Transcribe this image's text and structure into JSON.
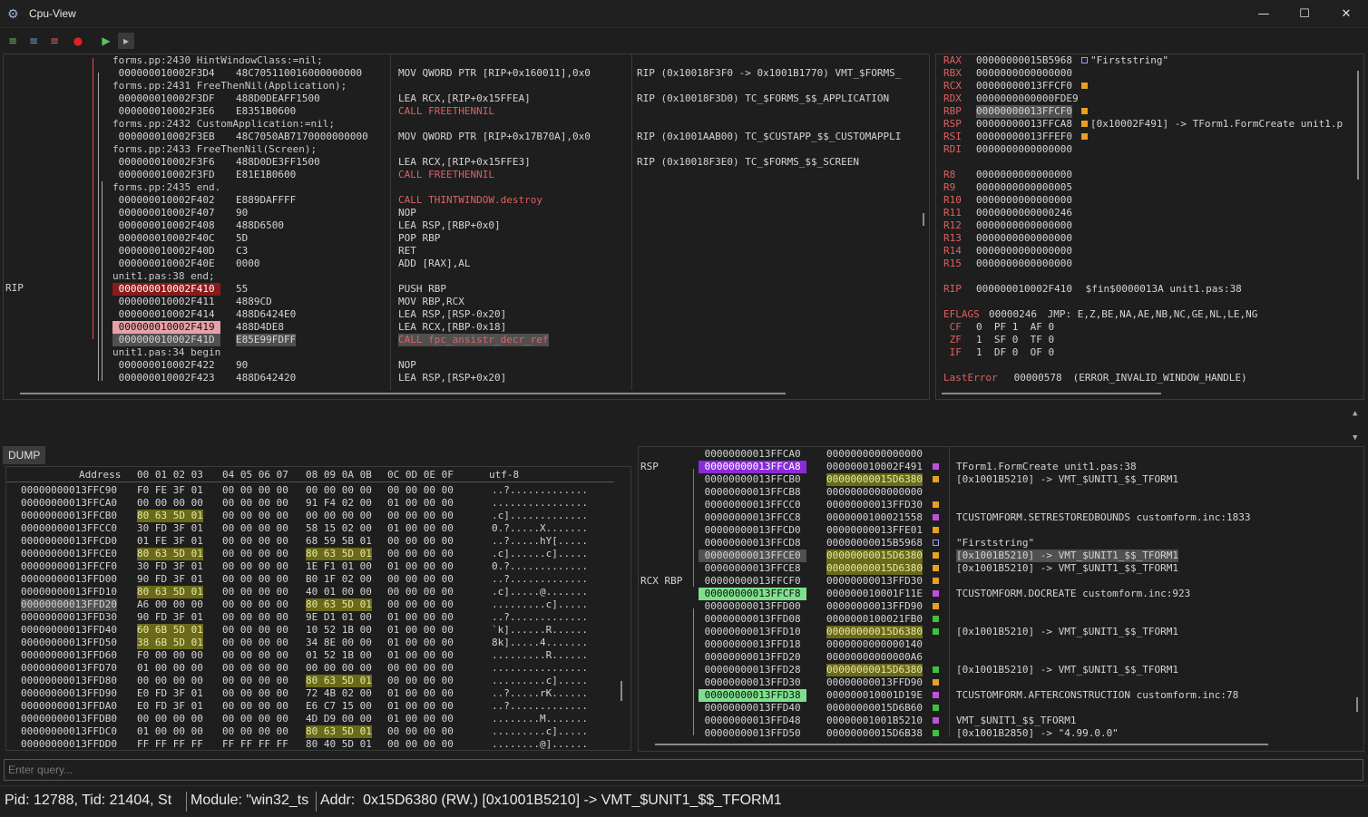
{
  "window": {
    "title": "Cpu-View",
    "minimize": "—",
    "maximize": "☐",
    "close": "✕"
  },
  "toolbar": {
    "buttons": [
      "step-into",
      "step-over",
      "step-out",
      "stop",
      "run-to",
      "run"
    ]
  },
  "disasm": {
    "rip_label": "RIP",
    "rows": [
      {
        "a": "forms.pp:2430 HintWindowClass:=nil;",
        "b": "",
        "c": "",
        "d": "",
        "t": "src"
      },
      {
        "a": "000000010002F3D4",
        "b": "48C705110016000000000",
        "c": "MOV QWORD PTR [RIP+0x160011],0x0",
        "d": "RIP (0x10018F3F0 -> 0x1001B1770) VMT_$FORMS_",
        "t": "code"
      },
      {
        "a": "forms.pp:2431 FreeThenNil(Application);",
        "b": "",
        "c": "",
        "d": "",
        "t": "src"
      },
      {
        "a": "000000010002F3DF",
        "b": "488D0DEAFF1500",
        "c": "LEA RCX,[RIP+0x15FFEA]",
        "d": "RIP (0x10018F3D0) TC_$FORMS_$$_APPLICATION",
        "t": "code"
      },
      {
        "a": "000000010002F3E6",
        "b": "E8351B0600",
        "c": "CALL FREETHENNIL",
        "d": "",
        "t": "code"
      },
      {
        "a": "forms.pp:2432 CustomApplication:=nil;",
        "b": "",
        "c": "",
        "d": "",
        "t": "src"
      },
      {
        "a": "000000010002F3EB",
        "b": "48C7050AB7170000000000",
        "c": "MOV QWORD PTR [RIP+0x17B70A],0x0",
        "d": "RIP (0x1001AAB00) TC_$CUSTAPP_$$_CUSTOMAPPLI",
        "t": "code"
      },
      {
        "a": "forms.pp:2433 FreeThenNil(Screen);",
        "b": "",
        "c": "",
        "d": "",
        "t": "src"
      },
      {
        "a": "000000010002F3F6",
        "b": "488D0DE3FF1500",
        "c": "LEA RCX,[RIP+0x15FFE3]",
        "d": "RIP (0x10018F3E0) TC_$FORMS_$$_SCREEN",
        "t": "code"
      },
      {
        "a": "000000010002F3FD",
        "b": "E81E1B0600",
        "c": "CALL FREETHENNIL",
        "d": "",
        "t": "code"
      },
      {
        "a": "forms.pp:2435 end.",
        "b": "",
        "c": "",
        "d": "",
        "t": "src"
      },
      {
        "a": "000000010002F402",
        "b": "E889DAFFFF",
        "c": "CALL THINTWINDOW.destroy",
        "d": "",
        "t": "code"
      },
      {
        "a": "000000010002F407",
        "b": "90",
        "c": "NOP",
        "d": "",
        "t": "code"
      },
      {
        "a": "000000010002F408",
        "b": "488D6500",
        "c": "LEA RSP,[RBP+0x0]",
        "d": "",
        "t": "code"
      },
      {
        "a": "000000010002F40C",
        "b": "5D",
        "c": "POP RBP",
        "d": "",
        "t": "code"
      },
      {
        "a": "000000010002F40D",
        "b": "C3",
        "c": "RET",
        "d": "",
        "t": "code"
      },
      {
        "a": "000000010002F40E",
        "b": "0000",
        "c": "ADD [RAX],AL",
        "d": "",
        "t": "code"
      },
      {
        "a": "unit1.pas:38 end;",
        "b": "",
        "c": "",
        "d": "",
        "t": "src"
      },
      {
        "a": "000000010002F410",
        "b": "55",
        "c": "PUSH RBP",
        "d": "",
        "t": "rip"
      },
      {
        "a": "000000010002F411",
        "b": "4889CD",
        "c": "MOV RBP,RCX",
        "d": "",
        "t": "code"
      },
      {
        "a": "000000010002F414",
        "b": "488D6424E0",
        "c": "LEA RSP,[RSP-0x20]",
        "d": "",
        "t": "code"
      },
      {
        "a": "000000010002F419",
        "b": "488D4DE8",
        "c": "LEA RCX,[RBP-0x18]",
        "d": "",
        "t": "pink"
      },
      {
        "a": "000000010002F41D",
        "b": "E85E99FDFF",
        "c": "CALL fpc_ansistr_decr_ref",
        "d": "",
        "t": "gray"
      },
      {
        "a": "unit1.pas:34 begin",
        "b": "",
        "c": "",
        "d": "",
        "t": "src"
      },
      {
        "a": "000000010002F422",
        "b": "90",
        "c": "NOP",
        "d": "",
        "t": "code"
      },
      {
        "a": "000000010002F423",
        "b": "488D642420",
        "c": "LEA RSP,[RSP+0x20]",
        "d": "",
        "t": "code"
      }
    ]
  },
  "registers": {
    "rows": [
      {
        "n": "RAX",
        "v": "00000000015B5968",
        "m": "b",
        "x": "\"Firststring\""
      },
      {
        "n": "RBX",
        "v": "0000000000000000",
        "m": "",
        "x": ""
      },
      {
        "n": "RCX",
        "v": "00000000013FFCF0",
        "m": "o",
        "x": ""
      },
      {
        "n": "RDX",
        "v": "0000000000000FDE9",
        "m": "",
        "x": ""
      },
      {
        "n": "RBP",
        "v": "00000000013FFCF0",
        "m": "o",
        "x": ""
      },
      {
        "n": "RSP",
        "v": "00000000013FFCA8",
        "m": "o",
        "x": "[0x10002F491] -> TForm1.FormCreate unit1.p"
      },
      {
        "n": "RSI",
        "v": "00000000013FFEF0",
        "m": "o",
        "x": ""
      },
      {
        "n": "RDI",
        "v": "0000000000000000",
        "m": "",
        "x": ""
      },
      {
        "n": "",
        "v": "",
        "m": "",
        "x": ""
      },
      {
        "n": "R8 ",
        "v": "0000000000000000",
        "m": "",
        "x": ""
      },
      {
        "n": "R9 ",
        "v": "0000000000000005",
        "m": "",
        "x": ""
      },
      {
        "n": "R10",
        "v": "0000000000000000",
        "m": "",
        "x": ""
      },
      {
        "n": "R11",
        "v": "0000000000000246",
        "m": "",
        "x": ""
      },
      {
        "n": "R12",
        "v": "0000000000000000",
        "m": "",
        "x": ""
      },
      {
        "n": "R13",
        "v": "0000000000000000",
        "m": "",
        "x": ""
      },
      {
        "n": "R14",
        "v": "0000000000000000",
        "m": "",
        "x": ""
      },
      {
        "n": "R15",
        "v": "0000000000000000",
        "m": "",
        "x": ""
      },
      {
        "n": "",
        "v": "",
        "m": "",
        "x": ""
      },
      {
        "n": "RIP",
        "v": "000000010002F410",
        "m": "",
        "x": " $fin$0000013A unit1.pas:38"
      },
      {
        "n": "",
        "v": "",
        "m": "",
        "x": ""
      },
      {
        "n": "EFLAGS",
        "v": "00000246",
        "m": "",
        "x": " JMP: E,Z,BE,NA,AE,NB,NC,GE,NL,LE,NG"
      },
      {
        "n": " CF",
        "v": "0  PF 1  AF 0",
        "m": "",
        "x": ""
      },
      {
        "n": " ZF",
        "v": "1  SF 0  TF 0",
        "m": "",
        "x": ""
      },
      {
        "n": " IF",
        "v": "1  DF 0  OF 0",
        "m": "",
        "x": ""
      },
      {
        "n": "",
        "v": "",
        "m": "",
        "x": ""
      },
      {
        "n": "LastError",
        "v": " 00000578",
        "m": "",
        "x": " (ERROR_INVALID_WINDOW_HANDLE)"
      }
    ]
  },
  "dump": {
    "tab": "DUMP 0",
    "headers": {
      "addr": "Address",
      "g1": "00 01 02 03",
      "g2": "04 05 06 07",
      "g3": "08 09 0A 0B",
      "g4": "0C 0D 0E 0F",
      "utf": "utf-8"
    },
    "rows": [
      {
        "a": "00000000013FFC90",
        "g": [
          "F0 FE 3F 01",
          "00 00 00 00",
          "00 00 00 00",
          "00 00 00 00"
        ],
        "u": "..?............."
      },
      {
        "a": "00000000013FFCA0",
        "g": [
          "00 00 00 00",
          "00 00 00 00",
          "91 F4 02 00",
          "01 00 00 00"
        ],
        "u": "................"
      },
      {
        "a": "00000000013FFCB0",
        "g": [
          "80 63 5D 01",
          "00 00 00 00",
          "00 00 00 00",
          "00 00 00 00"
        ],
        "u": ".c]............."
      },
      {
        "a": "00000000013FFCC0",
        "g": [
          "30 FD 3F 01",
          "00 00 00 00",
          "58 15 02 00",
          "01 00 00 00"
        ],
        "u": "0.?.....X......."
      },
      {
        "a": "00000000013FFCD0",
        "g": [
          "01 FE 3F 01",
          "00 00 00 00",
          "68 59 5B 01",
          "00 00 00 00"
        ],
        "u": "..?.....hY[....."
      },
      {
        "a": "00000000013FFCE0",
        "g": [
          "80 63 5D 01",
          "00 00 00 00",
          "80 63 5D 01",
          "00 00 00 00"
        ],
        "u": ".c]......c]....."
      },
      {
        "a": "00000000013FFCF0",
        "g": [
          "30 FD 3F 01",
          "00 00 00 00",
          "1E F1 01 00",
          "01 00 00 00"
        ],
        "u": "0.?............."
      },
      {
        "a": "00000000013FFD00",
        "g": [
          "90 FD 3F 01",
          "00 00 00 00",
          "B0 1F 02 00",
          "00 00 00 00"
        ],
        "u": "..?............."
      },
      {
        "a": "00000000013FFD10",
        "g": [
          "80 63 5D 01",
          "00 00 00 00",
          "40 01 00 00",
          "00 00 00 00"
        ],
        "u": ".c].....@......."
      },
      {
        "a": "00000000013FFD20",
        "g": [
          "A6 00 00 00",
          "00 00 00 00",
          "80 63 5D 01",
          "00 00 00 00"
        ],
        "u": ".........c]....."
      },
      {
        "a": "00000000013FFD30",
        "g": [
          "90 FD 3F 01",
          "00 00 00 00",
          "9E D1 01 00",
          "01 00 00 00"
        ],
        "u": "..?............."
      },
      {
        "a": "00000000013FFD40",
        "g": [
          "60 6B 5D 01",
          "00 00 00 00",
          "10 52 1B 00",
          "01 00 00 00"
        ],
        "u": "`k]......R......"
      },
      {
        "a": "00000000013FFD50",
        "g": [
          "38 6B 5D 01",
          "00 00 00 00",
          "34 8E 00 00",
          "01 00 00 00"
        ],
        "u": "8k].....4......."
      },
      {
        "a": "00000000013FFD60",
        "g": [
          "F0 00 00 00",
          "00 00 00 00",
          "01 52 1B 00",
          "01 00 00 00"
        ],
        "u": ".........R......"
      },
      {
        "a": "00000000013FFD70",
        "g": [
          "01 00 00 00",
          "00 00 00 00",
          "00 00 00 00",
          "00 00 00 00"
        ],
        "u": "................"
      },
      {
        "a": "00000000013FFD80",
        "g": [
          "00 00 00 00",
          "00 00 00 00",
          "80 63 5D 01",
          "00 00 00 00"
        ],
        "u": ".........c]....."
      },
      {
        "a": "00000000013FFD90",
        "g": [
          "E0 FD 3F 01",
          "00 00 00 00",
          "72 4B 02 00",
          "01 00 00 00"
        ],
        "u": "..?.....rK......"
      },
      {
        "a": "00000000013FFDA0",
        "g": [
          "E0 FD 3F 01",
          "00 00 00 00",
          "E6 C7 15 00",
          "01 00 00 00"
        ],
        "u": "..?............."
      },
      {
        "a": "00000000013FFDB0",
        "g": [
          "00 00 00 00",
          "00 00 00 00",
          "4D D9 00 00",
          "01 00 00 00"
        ],
        "u": "........M......."
      },
      {
        "a": "00000000013FFDC0",
        "g": [
          "01 00 00 00",
          "00 00 00 00",
          "80 63 5D 01",
          "00 00 00 00"
        ],
        "u": ".........c]....."
      },
      {
        "a": "00000000013FFDD0",
        "g": [
          "FF FF FF FF",
          "FF FF FF FF",
          "80 40 5D 01",
          "00 00 00 00"
        ],
        "u": "........@]......"
      }
    ]
  },
  "stack": {
    "rsp_label": "RSP",
    "rcx_rbp_label": "RCX RBP",
    "rows": [
      {
        "a": "00000000013FFCA0",
        "v": "0000000000000000",
        "m": "",
        "c": ""
      },
      {
        "a": "00000000013FFCA8",
        "v": "000000010002F491",
        "m": "p",
        "c": "TForm1.FormCreate unit1.pas:38"
      },
      {
        "a": "00000000013FFCB0",
        "v": "00000000015D6380",
        "m": "o",
        "c": "[0x1001B5210] -> VMT_$UNIT1_$$_TFORM1"
      },
      {
        "a": "00000000013FFCB8",
        "v": "0000000000000000",
        "m": "",
        "c": ""
      },
      {
        "a": "00000000013FFCC0",
        "v": "00000000013FFD30",
        "m": "o",
        "c": ""
      },
      {
        "a": "00000000013FFCC8",
        "v": "0000000100021558",
        "m": "p",
        "c": "TCUSTOMFORM.SETRESTOREDBOUNDS customform.inc:1833"
      },
      {
        "a": "00000000013FFCD0",
        "v": "00000000013FFE01",
        "m": "o",
        "c": ""
      },
      {
        "a": "00000000013FFCD8",
        "v": "00000000015B5968",
        "m": "b",
        "c": "\"Firststring\""
      },
      {
        "a": "00000000013FFCE0",
        "v": "00000000015D6380",
        "m": "o",
        "c": "[0x1001B5210] -> VMT_$UNIT1_$$_TFORM1"
      },
      {
        "a": "00000000013FFCE8",
        "v": "00000000015D6380",
        "m": "o",
        "c": "[0x1001B5210] -> VMT_$UNIT1_$$_TFORM1"
      },
      {
        "a": "00000000013FFCF0",
        "v": "00000000013FFD30",
        "m": "o",
        "c": ""
      },
      {
        "a": "00000000013FFCF8",
        "v": "000000010001F11E",
        "m": "p",
        "c": "TCUSTOMFORM.DOCREATE customform.inc:923"
      },
      {
        "a": "00000000013FFD00",
        "v": "00000000013FFD90",
        "m": "o",
        "c": ""
      },
      {
        "a": "00000000013FFD08",
        "v": "0000000100021FB0",
        "m": "g",
        "c": ""
      },
      {
        "a": "00000000013FFD10",
        "v": "00000000015D6380",
        "m": "g",
        "c": "[0x1001B5210] -> VMT_$UNIT1_$$_TFORM1"
      },
      {
        "a": "00000000013FFD18",
        "v": "0000000000000140",
        "m": "",
        "c": ""
      },
      {
        "a": "00000000013FFD20",
        "v": "00000000000000A6",
        "m": "",
        "c": ""
      },
      {
        "a": "00000000013FFD28",
        "v": "00000000015D6380",
        "m": "g",
        "c": "[0x1001B5210] -> VMT_$UNIT1_$$_TFORM1"
      },
      {
        "a": "00000000013FFD30",
        "v": "00000000013FFD90",
        "m": "o",
        "c": ""
      },
      {
        "a": "00000000013FFD38",
        "v": "000000010001D19E",
        "m": "p",
        "c": "TCUSTOMFORM.AFTERCONSTRUCTION customform.inc:78"
      },
      {
        "a": "00000000013FFD40",
        "v": "00000000015D6B60",
        "m": "g",
        "c": ""
      },
      {
        "a": "00000000013FFD48",
        "v": "00000001001B5210",
        "m": "p",
        "c": "VMT_$UNIT1_$$_TFORM1"
      },
      {
        "a": "00000000013FFD50",
        "v": "00000000015D6B38",
        "m": "g",
        "c": "[0x1001B2850] -> \"4.99.0.0\""
      }
    ]
  },
  "query": {
    "placeholder": "Enter query..."
  },
  "status": {
    "s1": "Pid: 12788, Tid: 21404, St",
    "s2": "Module: \"win32_ts",
    "s3": "Addr:  0x15D6380 (RW.) [0x1001B5210] -> VMT_$UNIT1_$$_TFORM1"
  }
}
